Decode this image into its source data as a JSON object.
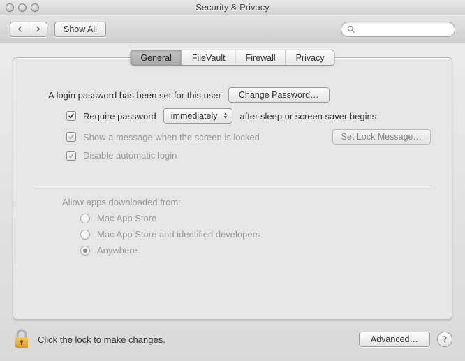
{
  "window": {
    "title": "Security & Privacy"
  },
  "toolbar": {
    "showall_label": "Show All",
    "search_placeholder": ""
  },
  "tabs": [
    {
      "label": "General",
      "selected": true
    },
    {
      "label": "FileVault",
      "selected": false
    },
    {
      "label": "Firewall",
      "selected": false
    },
    {
      "label": "Privacy",
      "selected": false
    }
  ],
  "general": {
    "password_msg": "A login password has been set for this user",
    "change_password_btn": "Change Password…",
    "require_pw": {
      "label": "Require password",
      "checked": true,
      "delay": "immediately",
      "suffix": "after sleep or screen saver begins"
    },
    "show_msg": {
      "label": "Show a message when the screen is locked",
      "checked": true,
      "btn": "Set Lock Message…"
    },
    "disable_auto": {
      "label": "Disable automatic login",
      "checked": true
    },
    "allow_heading": "Allow apps downloaded from:",
    "allow_options": [
      {
        "label": "Mac App Store",
        "selected": false
      },
      {
        "label": "Mac App Store and identified developers",
        "selected": false
      },
      {
        "label": "Anywhere",
        "selected": true
      }
    ]
  },
  "footer": {
    "lock_msg": "Click the lock to make changes.",
    "advanced_btn": "Advanced…"
  }
}
